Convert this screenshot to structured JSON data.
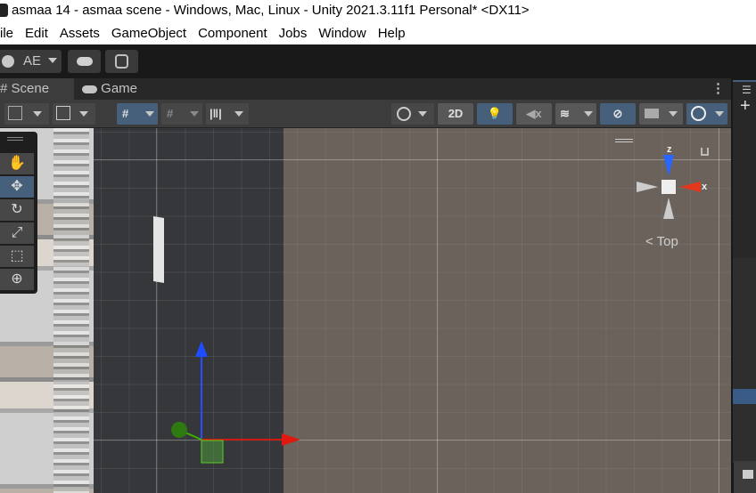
{
  "window": {
    "title": "asmaa 14 - asmaa scene - Windows, Mac, Linux - Unity 2021.3.11f1 Personal* <DX11>"
  },
  "menu": [
    "ile",
    "Edit",
    "Assets",
    "GameObject",
    "Component",
    "Jobs",
    "Window",
    "Help"
  ],
  "toolbar": {
    "account": "AE"
  },
  "tabs": {
    "scene": "Scene",
    "game": "Game"
  },
  "scene_toolbar": {
    "mode_2d": "2D"
  },
  "gizmo": {
    "z": "z",
    "x": "x",
    "view": "Top"
  },
  "colors": {
    "accent": "#46607c",
    "x_axis": "#e0301e",
    "y_axis": "#3cb300",
    "z_axis": "#2a5cff"
  }
}
